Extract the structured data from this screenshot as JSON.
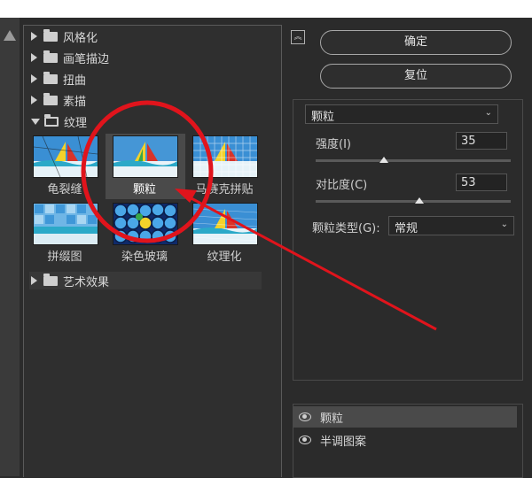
{
  "categories": {
    "stylize": "风格化",
    "brush_strokes": "画笔描边",
    "distort": "扭曲",
    "sketch": "素描",
    "texture": "纹理",
    "artistic": "艺术效果"
  },
  "texture_filters": [
    "龟裂缝",
    "颗粒",
    "马赛克拼贴",
    "拼缀图",
    "染色玻璃",
    "纹理化"
  ],
  "buttons": {
    "ok": "确定",
    "reset": "复位"
  },
  "settings": {
    "filter_select": "颗粒",
    "intensity_label": "强度(I)",
    "intensity_value": "35",
    "intensity_level": 0.35,
    "contrast_label": "对比度(C)",
    "contrast_value": "53",
    "contrast_level": 0.53,
    "grain_type_label": "颗粒类型(G):",
    "grain_type_value": "常规"
  },
  "layers": [
    "颗粒",
    "半调图案"
  ],
  "colors": {
    "annotation": "#e0141c",
    "selected_bg": "#4a4a4a"
  }
}
